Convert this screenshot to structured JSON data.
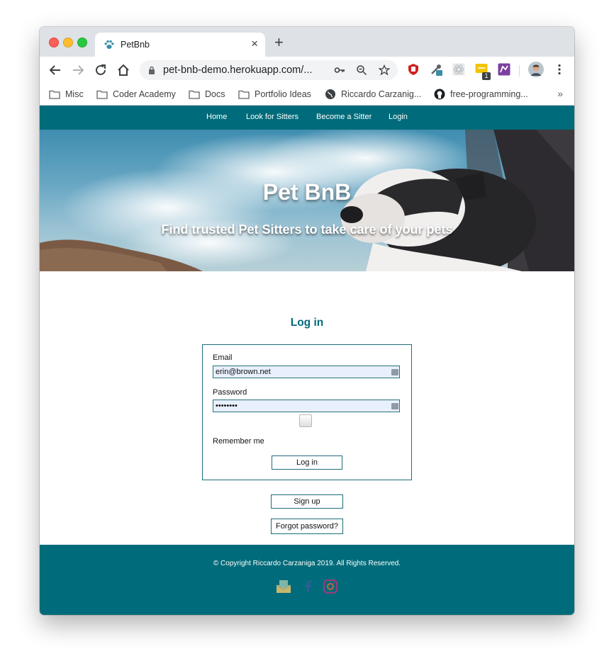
{
  "browser": {
    "tab_title": "PetBnb",
    "url": "pet-bnb-demo.herokuapp.com/...",
    "extension_badge": "1",
    "bookmarks": [
      {
        "label": "Misc",
        "icon": "folder-icon"
      },
      {
        "label": "Coder Academy",
        "icon": "folder-icon"
      },
      {
        "label": "Docs",
        "icon": "folder-icon"
      },
      {
        "label": "Portfolio Ideas",
        "icon": "folder-icon"
      },
      {
        "label": "Riccardo Carzanig...",
        "icon": "globe-icon"
      },
      {
        "label": "free-programming...",
        "icon": "github-icon"
      }
    ],
    "more_bookmarks": "»"
  },
  "nav": {
    "links": [
      "Home",
      "Look for Sitters",
      "Become a Sitter",
      "Login"
    ]
  },
  "hero": {
    "title": "Pet BnB",
    "subtitle": "Find trusted Pet Sitters to take care of your pets"
  },
  "login": {
    "heading": "Log in",
    "email_label": "Email",
    "email_value": "erin@brown.net",
    "password_label": "Password",
    "password_value": "••••••••",
    "remember_label": "Remember me",
    "submit_label": "Log in"
  },
  "links": {
    "signup_label": "Sign up",
    "forgot_label": "Forgot password?"
  },
  "footer": {
    "copyright": "© Copyright Riccardo Carzaniga 2019. All Rights Reserved.",
    "social_icons": [
      "mail-icon",
      "facebook-icon",
      "instagram-icon"
    ]
  },
  "colors": {
    "brand_teal": "#006b7a",
    "autofill_blue": "#e8f0fe"
  }
}
